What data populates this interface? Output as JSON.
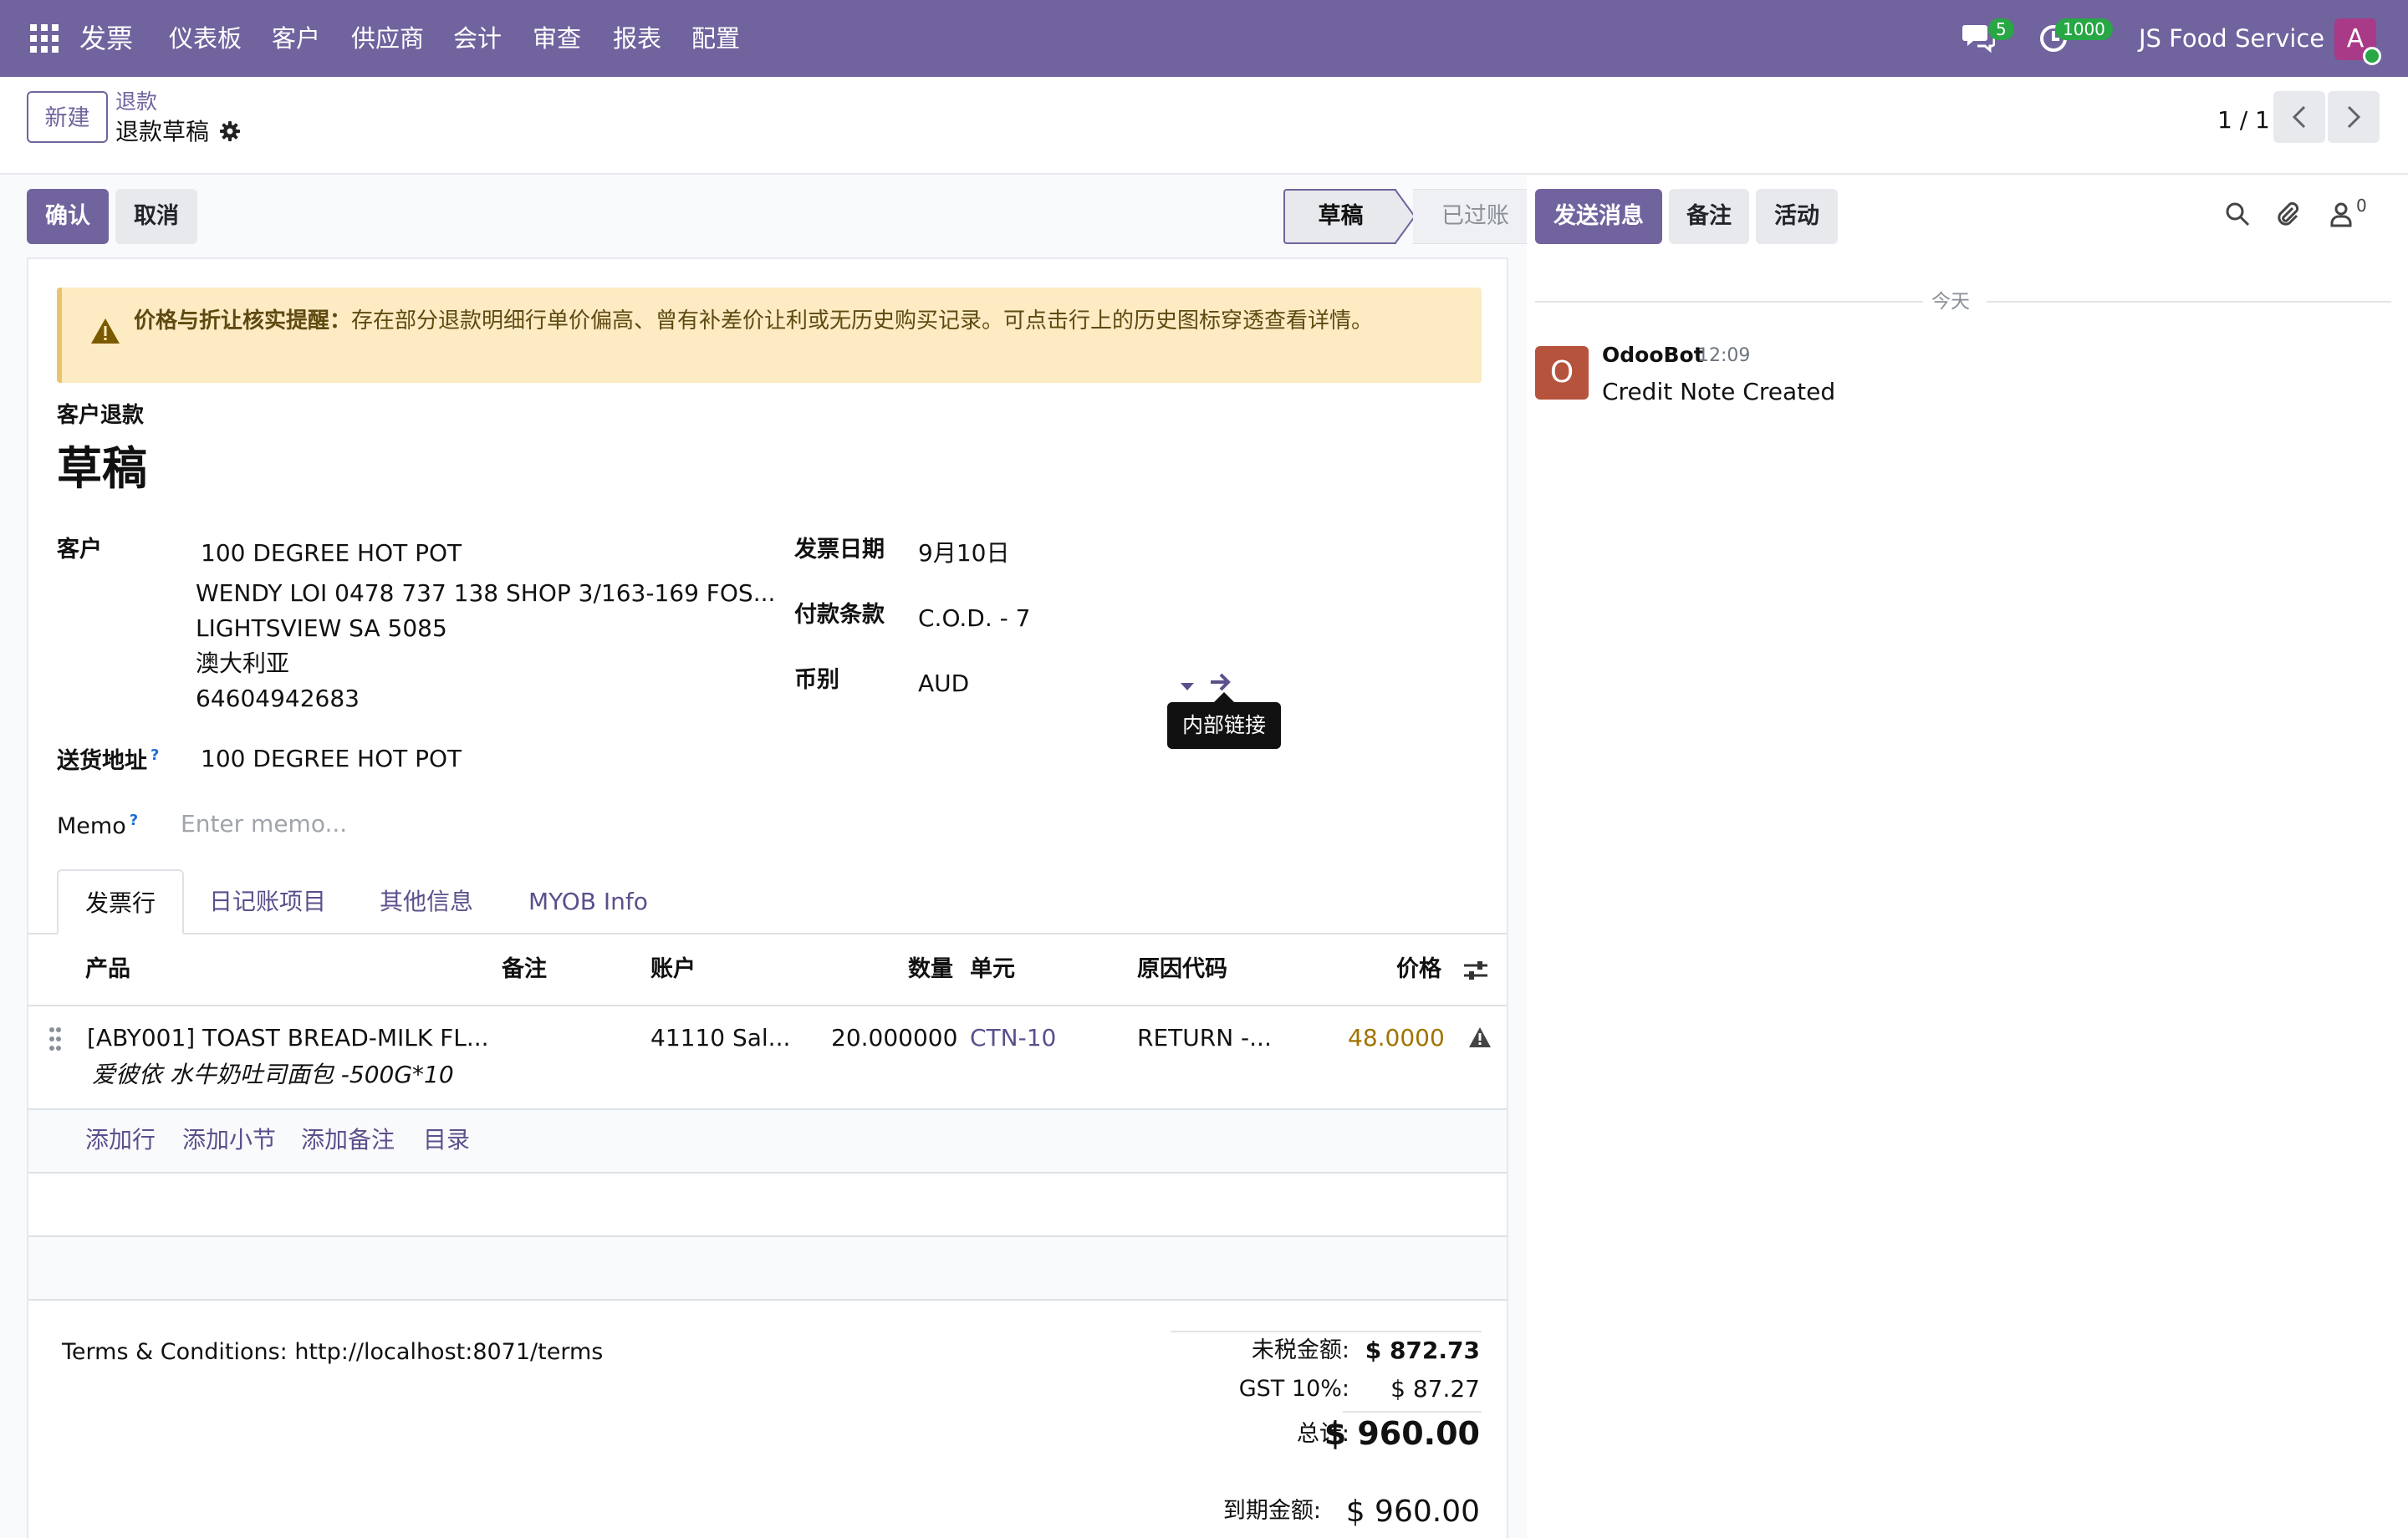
{
  "navbar": {
    "brand": "发票",
    "menus": [
      "仪表板",
      "客户",
      "供应商",
      "会计",
      "审查",
      "报表",
      "配置"
    ],
    "messages_count": "5",
    "activities_count": "1000",
    "company": "JS Food Service",
    "user_initial": "A",
    "color": "#71639e"
  },
  "control": {
    "new_label": "新建",
    "breadcrumb_parent": "退款",
    "breadcrumb_current": "退款草稿",
    "pager": "1 / 1"
  },
  "actions": {
    "confirm": "确认",
    "cancel": "取消"
  },
  "status": {
    "draft": "草稿",
    "posted": "已过账"
  },
  "alert": {
    "title": "价格与折让核实提醒：",
    "body": "存在部分退款明细行单价偏高、曾有补差价让利或无历史购买记录。可点击行上的历史图标穿透查看详情。"
  },
  "record": {
    "move_type": "客户退款",
    "name": "草稿"
  },
  "fields": {
    "customer_label": "客户",
    "customer_name": "100 DEGREE HOT POT",
    "customer_address": [
      "WENDY LOI 0478 737 138 SHOP 3/163-169 FOS...",
      "LIGHTSVIEW SA 5085",
      "澳大利亚",
      "64604942683"
    ],
    "delivery_label": "送货地址",
    "delivery_value": "100 DEGREE HOT POT",
    "memo_label": "Memo",
    "memo_placeholder": "Enter memo...",
    "invoice_date_label": "发票日期",
    "invoice_date": "9月10日",
    "payment_terms_label": "付款条款",
    "payment_terms": "C.O.D. - 7",
    "currency_label": "币别",
    "currency": "AUD",
    "help_mark": "?",
    "tooltip": "内部链接"
  },
  "tabs": [
    "发票行",
    "日记账项目",
    "其他信息",
    "MYOB Info"
  ],
  "table": {
    "headers": {
      "product": "产品",
      "note": "备注",
      "account": "账户",
      "quantity": "数量",
      "unit": "单元",
      "reason": "原因代码",
      "price": "价格"
    },
    "rows": [
      {
        "product": "[ABY001] TOAST BREAD-MILK FL...",
        "description": "爱彼依 水牛奶吐司面包 -500G*10",
        "account": "41110 Sal...",
        "quantity": "20.000000",
        "unit": "CTN-10",
        "reason": "RETURN -...",
        "price": "48.0000"
      }
    ],
    "add_actions": [
      "添加行",
      "添加小节",
      "添加备注",
      "目录"
    ]
  },
  "footer": {
    "terms": "Terms & Conditions: http://localhost:8071/terms",
    "untaxed_label": "未税金额:",
    "untaxed_value": "$ 872.73",
    "gst_label": "GST 10%:",
    "gst_value": "$ 87.27",
    "total_label": "总计:",
    "total_value": "$ 960.00",
    "due_label": "到期金额:",
    "due_value": "$ 960.00"
  },
  "chatter": {
    "send_message": "发送消息",
    "log_note": "备注",
    "activity": "活动",
    "followers_count": "0",
    "today": "今天",
    "author_initial": "O",
    "author": "OdooBot",
    "time": "12:09",
    "message": "Credit Note Created"
  }
}
